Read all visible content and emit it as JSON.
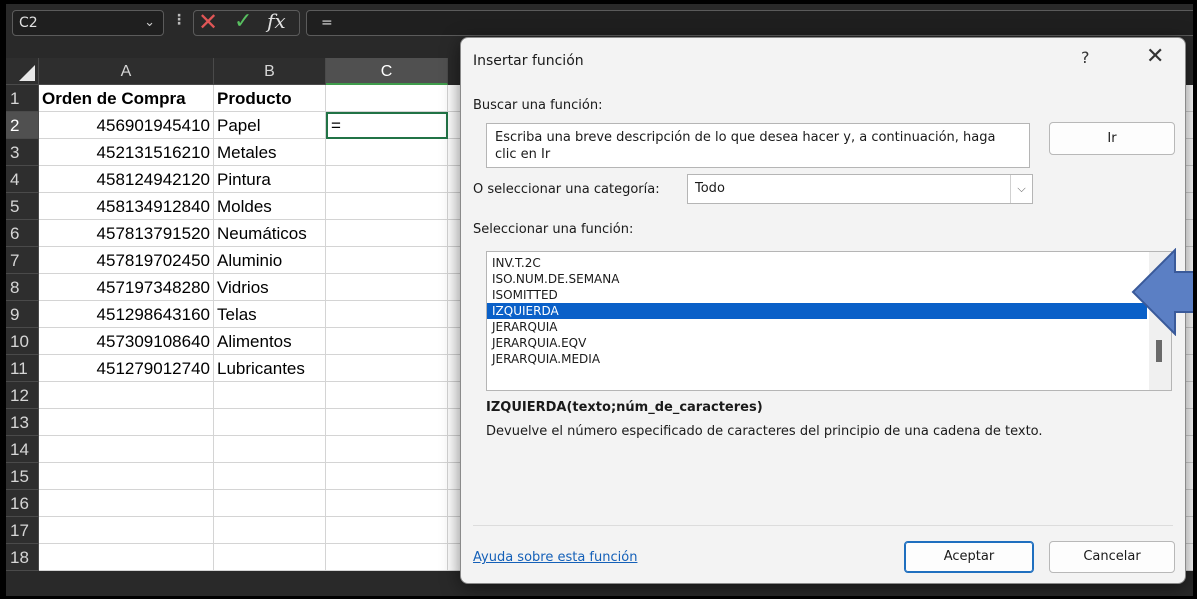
{
  "formula_bar": {
    "name_box": "C2",
    "name_box_chevron": "chevron-down-icon",
    "dots": "⋮",
    "cancel_glyph": "✕",
    "enter_glyph": "✓",
    "fx_label": "fx",
    "formula": "="
  },
  "sheet": {
    "columns": [
      "A",
      "B",
      "C"
    ],
    "rows": [
      "1",
      "2",
      "3",
      "4",
      "5",
      "6",
      "7",
      "8",
      "9",
      "10",
      "11",
      "12",
      "13",
      "14",
      "15",
      "16",
      "17",
      "18"
    ],
    "selected_cell": "C2",
    "header": {
      "a": "Orden de Compra",
      "b": "Producto"
    },
    "data": [
      {
        "a": "456901945410",
        "b": "Papel"
      },
      {
        "a": "452131516210",
        "b": "Metales"
      },
      {
        "a": "458124942120",
        "b": "Pintura"
      },
      {
        "a": "458134912840",
        "b": "Moldes"
      },
      {
        "a": "457813791520",
        "b": "Neumáticos"
      },
      {
        "a": "457819702450",
        "b": "Aluminio"
      },
      {
        "a": "457197348280",
        "b": "Vidrios"
      },
      {
        "a": "451298643160",
        "b": "Telas"
      },
      {
        "a": "457309108640",
        "b": "Alimentos"
      },
      {
        "a": "451279012740",
        "b": "Lubricantes"
      }
    ],
    "active_cell_value": "="
  },
  "dialog": {
    "title": "Insertar función",
    "help_glyph": "?",
    "close_glyph": "✕",
    "search_label": "Buscar una función:",
    "search_text": "Escriba una breve descripción de lo que desea hacer y, a continuación, haga clic en Ir",
    "go_button": "Ir",
    "category_label": "O seleccionar una categoría:",
    "category_value": "Todo",
    "function_label": "Seleccionar una función:",
    "functions": [
      "INV.T.2C",
      "ISO.NUM.DE.SEMANA",
      "ISOMITTED",
      "IZQUIERDA",
      "JERARQUIA",
      "JERARQUIA.EQV",
      "JERARQUIA.MEDIA"
    ],
    "selected_function": "IZQUIERDA",
    "signature": "IZQUIERDA(texto;núm_de_caracteres)",
    "description": "Devuelve el número especificado de caracteres del principio de una cadena de texto.",
    "help_link": "Ayuda sobre esta función",
    "ok_button": "Aceptar",
    "cancel_button": "Cancelar"
  },
  "annotation": {
    "arrow_icon": "left-arrow-icon",
    "color": "#5b7fc4"
  }
}
